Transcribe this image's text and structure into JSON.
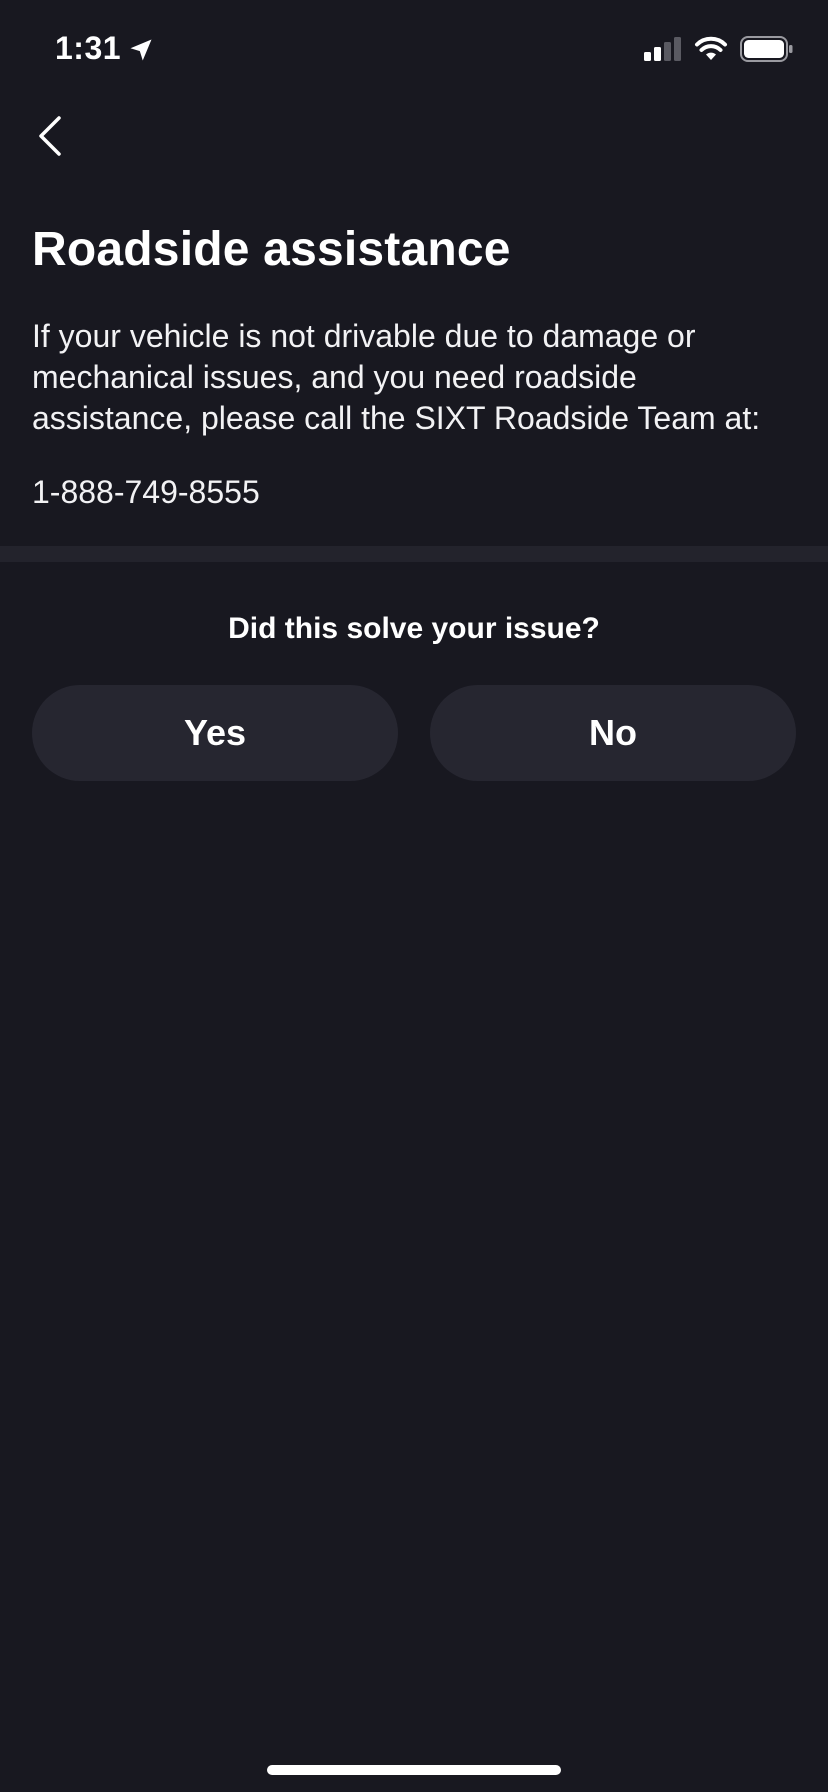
{
  "status_bar": {
    "time": "1:31",
    "location_icon": "location-arrow-icon",
    "signal_icon": "cellular-signal-icon",
    "wifi_icon": "wifi-icon",
    "battery_icon": "battery-icon"
  },
  "nav": {
    "back_icon": "chevron-left-icon"
  },
  "main": {
    "title": "Roadside assistance",
    "description": "If your vehicle is not drivable due to damage or mechanical issues, and you need roadside assistance, please call the SIXT Roadside Team at:",
    "phone": "1-888-749-8555"
  },
  "feedback": {
    "question": "Did this solve your issue?",
    "yes_label": "Yes",
    "no_label": "No"
  },
  "colors": {
    "background": "#181820",
    "button_background": "#262630",
    "divider": "#23232c",
    "text": "#ffffff"
  }
}
